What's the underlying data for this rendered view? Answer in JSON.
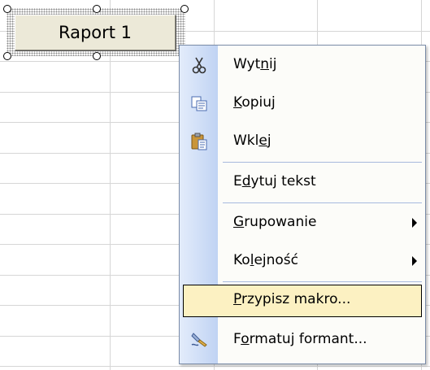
{
  "form_button": {
    "label": "Raport 1"
  },
  "context_menu": {
    "items": [
      {
        "pre": "Wyt",
        "u": "n",
        "post": "ij",
        "icon": "scissors-icon",
        "has_submenu": false
      },
      {
        "pre": "",
        "u": "K",
        "post": "opiuj",
        "icon": "copy-icon",
        "has_submenu": false
      },
      {
        "pre": "Wkl",
        "u": "e",
        "post": "j",
        "icon": "paste-icon",
        "has_submenu": false
      },
      {
        "pre": "E",
        "u": "d",
        "post": "ytuj tekst",
        "icon": "",
        "has_submenu": false
      },
      {
        "pre": "",
        "u": "G",
        "post": "rupowanie",
        "icon": "",
        "has_submenu": true
      },
      {
        "pre": "Ko",
        "u": "l",
        "post": "ejność",
        "icon": "",
        "has_submenu": true
      },
      {
        "pre": "",
        "u": "P",
        "post": "rzypisz makro...",
        "icon": "",
        "has_submenu": false,
        "highlighted": true
      },
      {
        "pre": "F",
        "u": "o",
        "post": "rmatuj formant...",
        "icon": "format-control-icon",
        "has_submenu": false
      }
    ]
  }
}
